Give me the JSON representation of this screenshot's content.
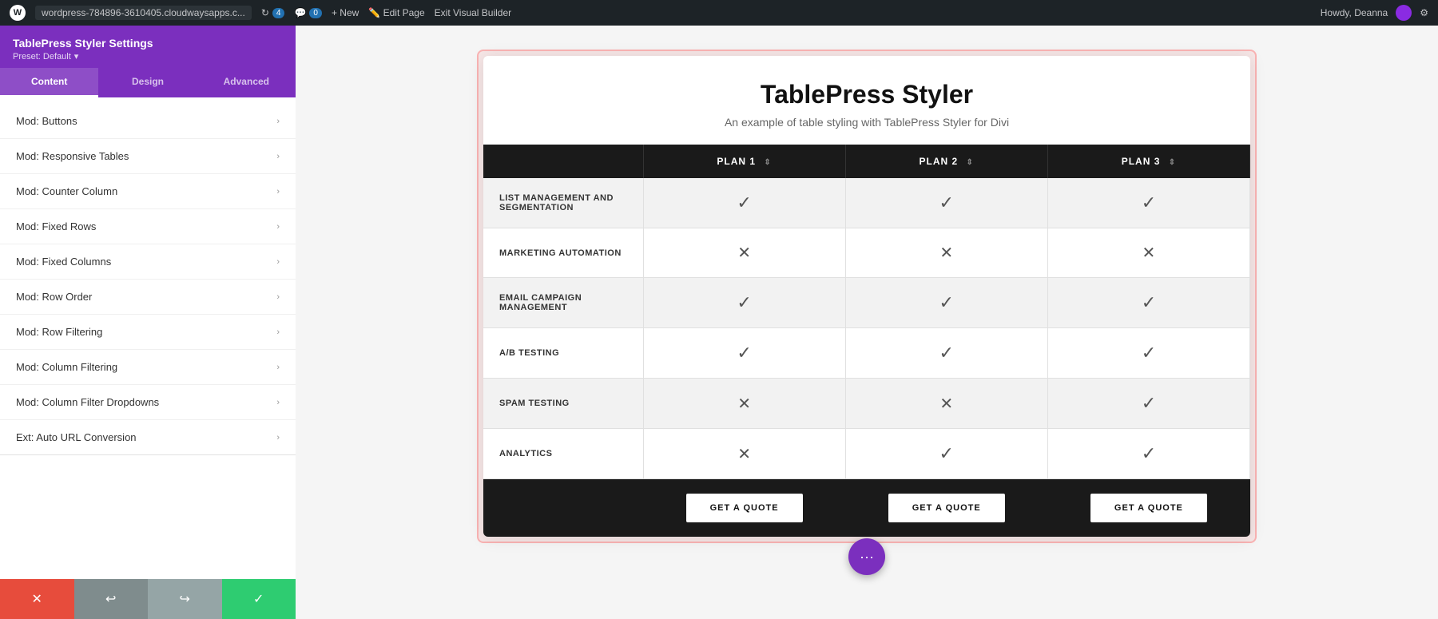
{
  "topbar": {
    "wp_logo": "W",
    "site_url": "wordpress-784896-3610405.cloudwaysapps.c...",
    "refresh_count": "4",
    "comment_count": "0",
    "new_label": "+ New",
    "edit_page_label": "Edit Page",
    "exit_vb_label": "Exit Visual Builder",
    "howdy_label": "Howdy, Deanna"
  },
  "sidebar": {
    "title": "TablePress Styler Settings",
    "preset_label": "Preset: Default",
    "tabs": [
      {
        "label": "Content",
        "active": true
      },
      {
        "label": "Design",
        "active": false
      },
      {
        "label": "Advanced",
        "active": false
      }
    ],
    "items": [
      {
        "label": "Mod: Buttons"
      },
      {
        "label": "Mod: Responsive Tables"
      },
      {
        "label": "Mod: Counter Column"
      },
      {
        "label": "Mod: Fixed Rows"
      },
      {
        "label": "Mod: Fixed Columns"
      },
      {
        "label": "Mod: Row Order"
      },
      {
        "label": "Mod: Row Filtering"
      },
      {
        "label": "Mod: Column Filtering"
      },
      {
        "label": "Mod: Column Filter Dropdowns"
      },
      {
        "label": "Ext: Auto URL Conversion"
      }
    ],
    "bottom_buttons": [
      {
        "icon": "✕",
        "type": "red",
        "label": "discard"
      },
      {
        "icon": "↩",
        "type": "gray-dark",
        "label": "undo"
      },
      {
        "icon": "↪",
        "type": "gray",
        "label": "redo"
      },
      {
        "icon": "✓",
        "type": "green",
        "label": "save"
      }
    ]
  },
  "table_press": {
    "title": "TablePress Styler",
    "subtitle": "An example of table styling with TablePress Styler for Divi",
    "headers": [
      "",
      "PLAN 1",
      "PLAN 2",
      "PLAN 3"
    ],
    "rows": [
      {
        "feature": "LIST MANAGEMENT AND SEGMENTATION",
        "plan1": "check",
        "plan2": "check",
        "plan3": "check"
      },
      {
        "feature": "MARKETING AUTOMATION",
        "plan1": "cross",
        "plan2": "cross",
        "plan3": "cross"
      },
      {
        "feature": "EMAIL CAMPAIGN MANAGEMENT",
        "plan1": "check",
        "plan2": "check",
        "plan3": "check"
      },
      {
        "feature": "A/B TESTING",
        "plan1": "check",
        "plan2": "check",
        "plan3": "check"
      },
      {
        "feature": "SPAM TESTING",
        "plan1": "cross",
        "plan2": "cross",
        "plan3": "check"
      },
      {
        "feature": "ANALYTICS",
        "plan1": "cross",
        "plan2": "check",
        "plan3": "check"
      }
    ],
    "footer_button_label": "GET A QUOTE",
    "fab_icon": "···"
  }
}
